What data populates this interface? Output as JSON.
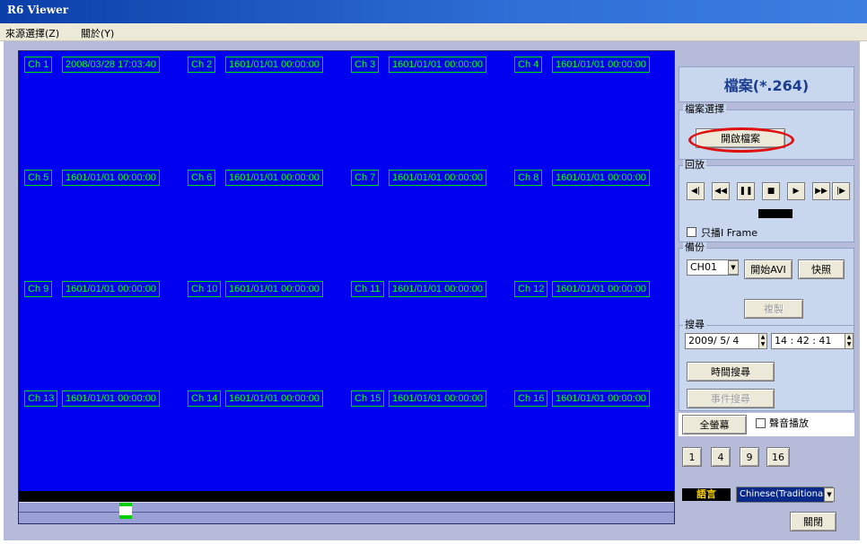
{
  "window": {
    "title": "R6 Viewer"
  },
  "menu": [
    {
      "label": "來源選擇(Z)"
    },
    {
      "label": "關於(Y)"
    }
  ],
  "channels": [
    {
      "label": "Ch 1",
      "time": "2008/03/28 17:03:40"
    },
    {
      "label": "Ch 2",
      "time": "1601/01/01 00:00:00"
    },
    {
      "label": "Ch 3",
      "time": "1601/01/01 00:00:00"
    },
    {
      "label": "Ch 4",
      "time": "1601/01/01 00:00:00"
    },
    {
      "label": "Ch 5",
      "time": "1601/01/01 00:00:00"
    },
    {
      "label": "Ch 6",
      "time": "1601/01/01 00:00:00"
    },
    {
      "label": "Ch 7",
      "time": "1601/01/01 00:00:00"
    },
    {
      "label": "Ch 8",
      "time": "1601/01/01 00:00:00"
    },
    {
      "label": "Ch 9",
      "time": "1601/01/01 00:00:00"
    },
    {
      "label": "Ch 10",
      "time": "1601/01/01 00:00:00"
    },
    {
      "label": "Ch 11",
      "time": "1601/01/01 00:00:00"
    },
    {
      "label": "Ch 12",
      "time": "1601/01/01 00:00:00"
    },
    {
      "label": "Ch 13",
      "time": "1601/01/01 00:00:00"
    },
    {
      "label": "Ch 14",
      "time": "1601/01/01 00:00:00"
    },
    {
      "label": "Ch 15",
      "time": "1601/01/01 00:00:00"
    },
    {
      "label": "Ch 16",
      "time": "1601/01/01 00:00:00"
    }
  ],
  "panel": {
    "header": "檔案(*.264)",
    "file_select": {
      "title": "檔案選擇",
      "open_button": "開啟檔案"
    },
    "playback": {
      "title": "回放",
      "only_iframe": "只播I Frame"
    },
    "backup": {
      "title": "備份",
      "channel": "CH01",
      "start_avi": "開始AVI",
      "snapshot": "快照",
      "copy": "複製"
    },
    "search": {
      "title": "搜尋",
      "date": "2009/ 5/ 4",
      "time": "14 : 42 : 41",
      "time_search": "時間搜尋",
      "event_search": "事件搜尋"
    },
    "fullscreen": "全螢幕",
    "audio": "聲音播放",
    "layouts": [
      "1",
      "4",
      "9",
      "16"
    ],
    "language_label": "語言",
    "language": "Chinese(Traditional)",
    "close": "關閉"
  },
  "colors": {
    "stage": "#0000f0",
    "osd": "#00ff33",
    "highlight": "#e01010"
  }
}
